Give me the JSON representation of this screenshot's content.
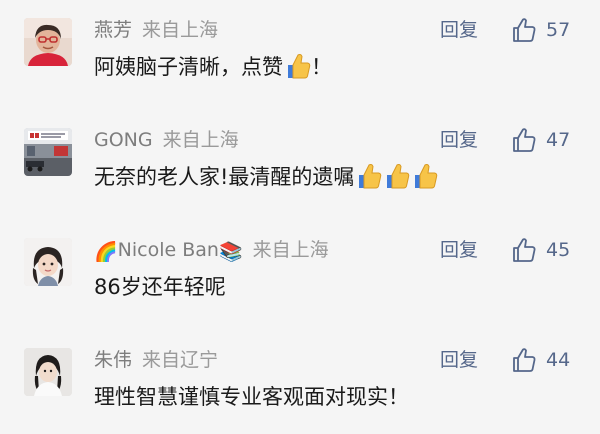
{
  "comments": [
    {
      "author": "燕芳",
      "location": "来自上海",
      "text": "阿姨脑子清晰，点赞",
      "text_suffix": "！",
      "thumbs": 1,
      "reply_label": "回复",
      "likes": "57",
      "avatar_icon": "avatar-woman-glasses-red"
    },
    {
      "author": "GONG",
      "location": "来自上海",
      "text": "无奈的老人家!最清醒的遗嘱",
      "text_suffix": "",
      "thumbs": 3,
      "reply_label": "回复",
      "likes": "47",
      "avatar_icon": "avatar-street-scene"
    },
    {
      "author_prefix_emoji": "🌈",
      "author": "Nicole Ban",
      "author_suffix_emoji": "📚",
      "location": "来自上海",
      "text": "86岁还年轻呢",
      "text_suffix": "",
      "thumbs": 0,
      "reply_label": "回复",
      "likes": "45",
      "avatar_icon": "avatar-cartoon-girl"
    },
    {
      "author": "朱伟",
      "location": "来自辽宁",
      "text": "理性智慧谨慎专业客观面对现实！",
      "text_suffix": "",
      "thumbs": 0,
      "reply_label": "回复",
      "likes": "44",
      "avatar_icon": "avatar-girl-photo"
    }
  ],
  "colors": {
    "background": "#f5f5f5",
    "meta_text": "#7d7d7d",
    "action_blue": "#55678a",
    "body_text": "#1a1a1a"
  }
}
